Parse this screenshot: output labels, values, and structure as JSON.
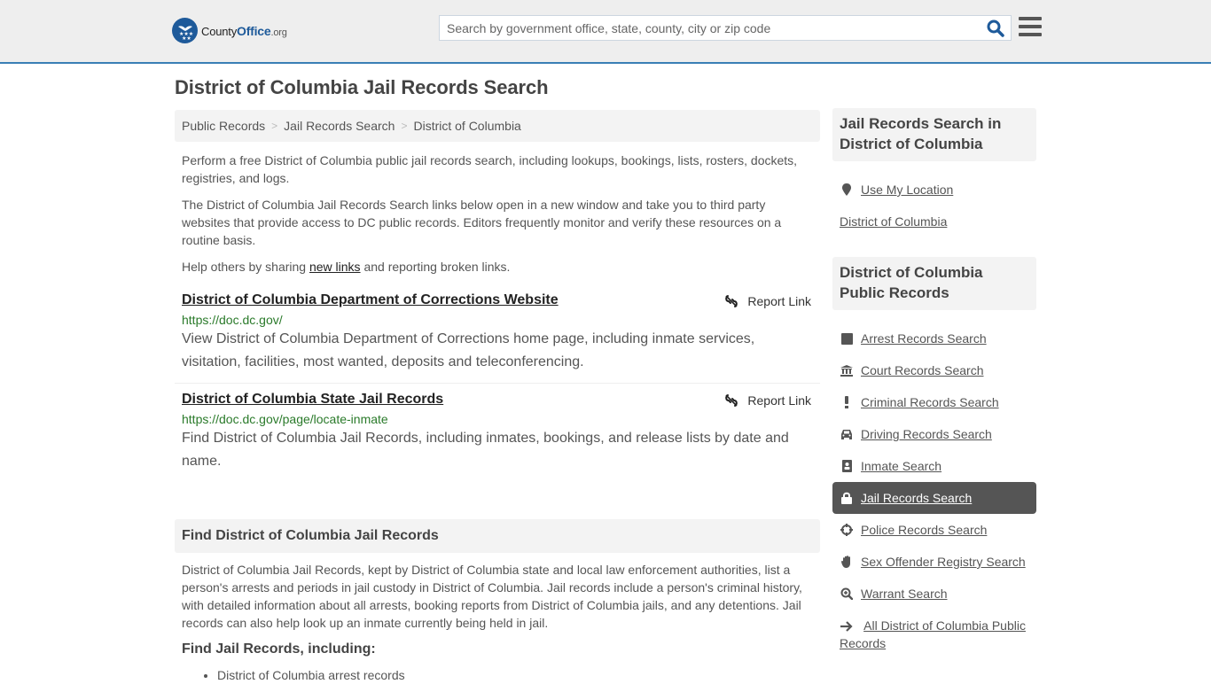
{
  "header": {
    "logo": {
      "name_part1": "County",
      "name_part2": "Office",
      "name_part3": ".org"
    },
    "search": {
      "placeholder": "Search by government office, state, county, city or zip code",
      "value": ""
    },
    "colors": {
      "brand": "#1e5a9a",
      "header_border": "#3a7fb5",
      "header_bg": "#eeeeee"
    }
  },
  "page": {
    "title": "District of Columbia Jail Records Search",
    "breadcrumb": [
      {
        "label": "Public Records"
      },
      {
        "label": "Jail Records Search"
      },
      {
        "label": "District of Columbia"
      }
    ],
    "intro": {
      "p1": "Perform a free District of Columbia public jail records search, including lookups, bookings, lists, rosters, dockets, registries, and logs.",
      "p2": "The District of Columbia Jail Records Search links below open in a new window and take you to third party websites that provide access to DC public records. Editors frequently monitor and verify these resources on a routine basis.",
      "p3_before": "Help others by sharing ",
      "p3_link": "new links",
      "p3_after": " and reporting broken links."
    },
    "results": [
      {
        "title": "District of Columbia Department of Corrections Website",
        "url": "https://doc.dc.gov/",
        "description": "View District of Columbia Department of Corrections home page, including inmate services, visitation, facilities, most wanted, deposits and teleconferencing.",
        "report_label": "Report Link"
      },
      {
        "title": "District of Columbia State Jail Records",
        "url": "https://doc.dc.gov/page/locate-inmate",
        "description": "Find District of Columbia Jail Records, including inmates, bookings, and release lists by date and name.",
        "report_label": "Report Link"
      }
    ],
    "find_section": {
      "heading": "Find District of Columbia Jail Records",
      "body": "District of Columbia Jail Records, kept by District of Columbia state and local law enforcement authorities, list a person's arrests and periods in jail custody in District of Columbia. Jail records include a person's criminal history, with detailed information about all arrests, booking reports from District of Columbia jails, and any detentions. Jail records can also help look up an inmate currently being held in jail.",
      "subheading": "Find Jail Records, including:",
      "list": [
        "District of Columbia arrest records"
      ]
    }
  },
  "sidebar": {
    "location_box": {
      "heading": "Jail Records Search in District of Columbia",
      "use_location": "Use My Location",
      "location_link": "District of Columbia"
    },
    "public_records_box": {
      "heading": "District of Columbia Public Records",
      "items": [
        {
          "label": "Arrest Records Search",
          "icon": "square-icon",
          "active": false
        },
        {
          "label": "Court Records Search",
          "icon": "courthouse-icon",
          "active": false
        },
        {
          "label": "Criminal Records Search",
          "icon": "exclamation-icon",
          "active": false
        },
        {
          "label": "Driving Records Search",
          "icon": "car-icon",
          "active": false
        },
        {
          "label": "Inmate Search",
          "icon": "id-badge-icon",
          "active": false
        },
        {
          "label": "Jail Records Search",
          "icon": "lock-icon",
          "active": true
        },
        {
          "label": "Police Records Search",
          "icon": "crosshairs-icon",
          "active": false
        },
        {
          "label": "Sex Offender Registry Search",
          "icon": "hand-icon",
          "active": false
        },
        {
          "label": "Warrant Search",
          "icon": "zoom-in-icon",
          "active": false
        }
      ],
      "all_link": "All District of Columbia Public Records"
    }
  }
}
